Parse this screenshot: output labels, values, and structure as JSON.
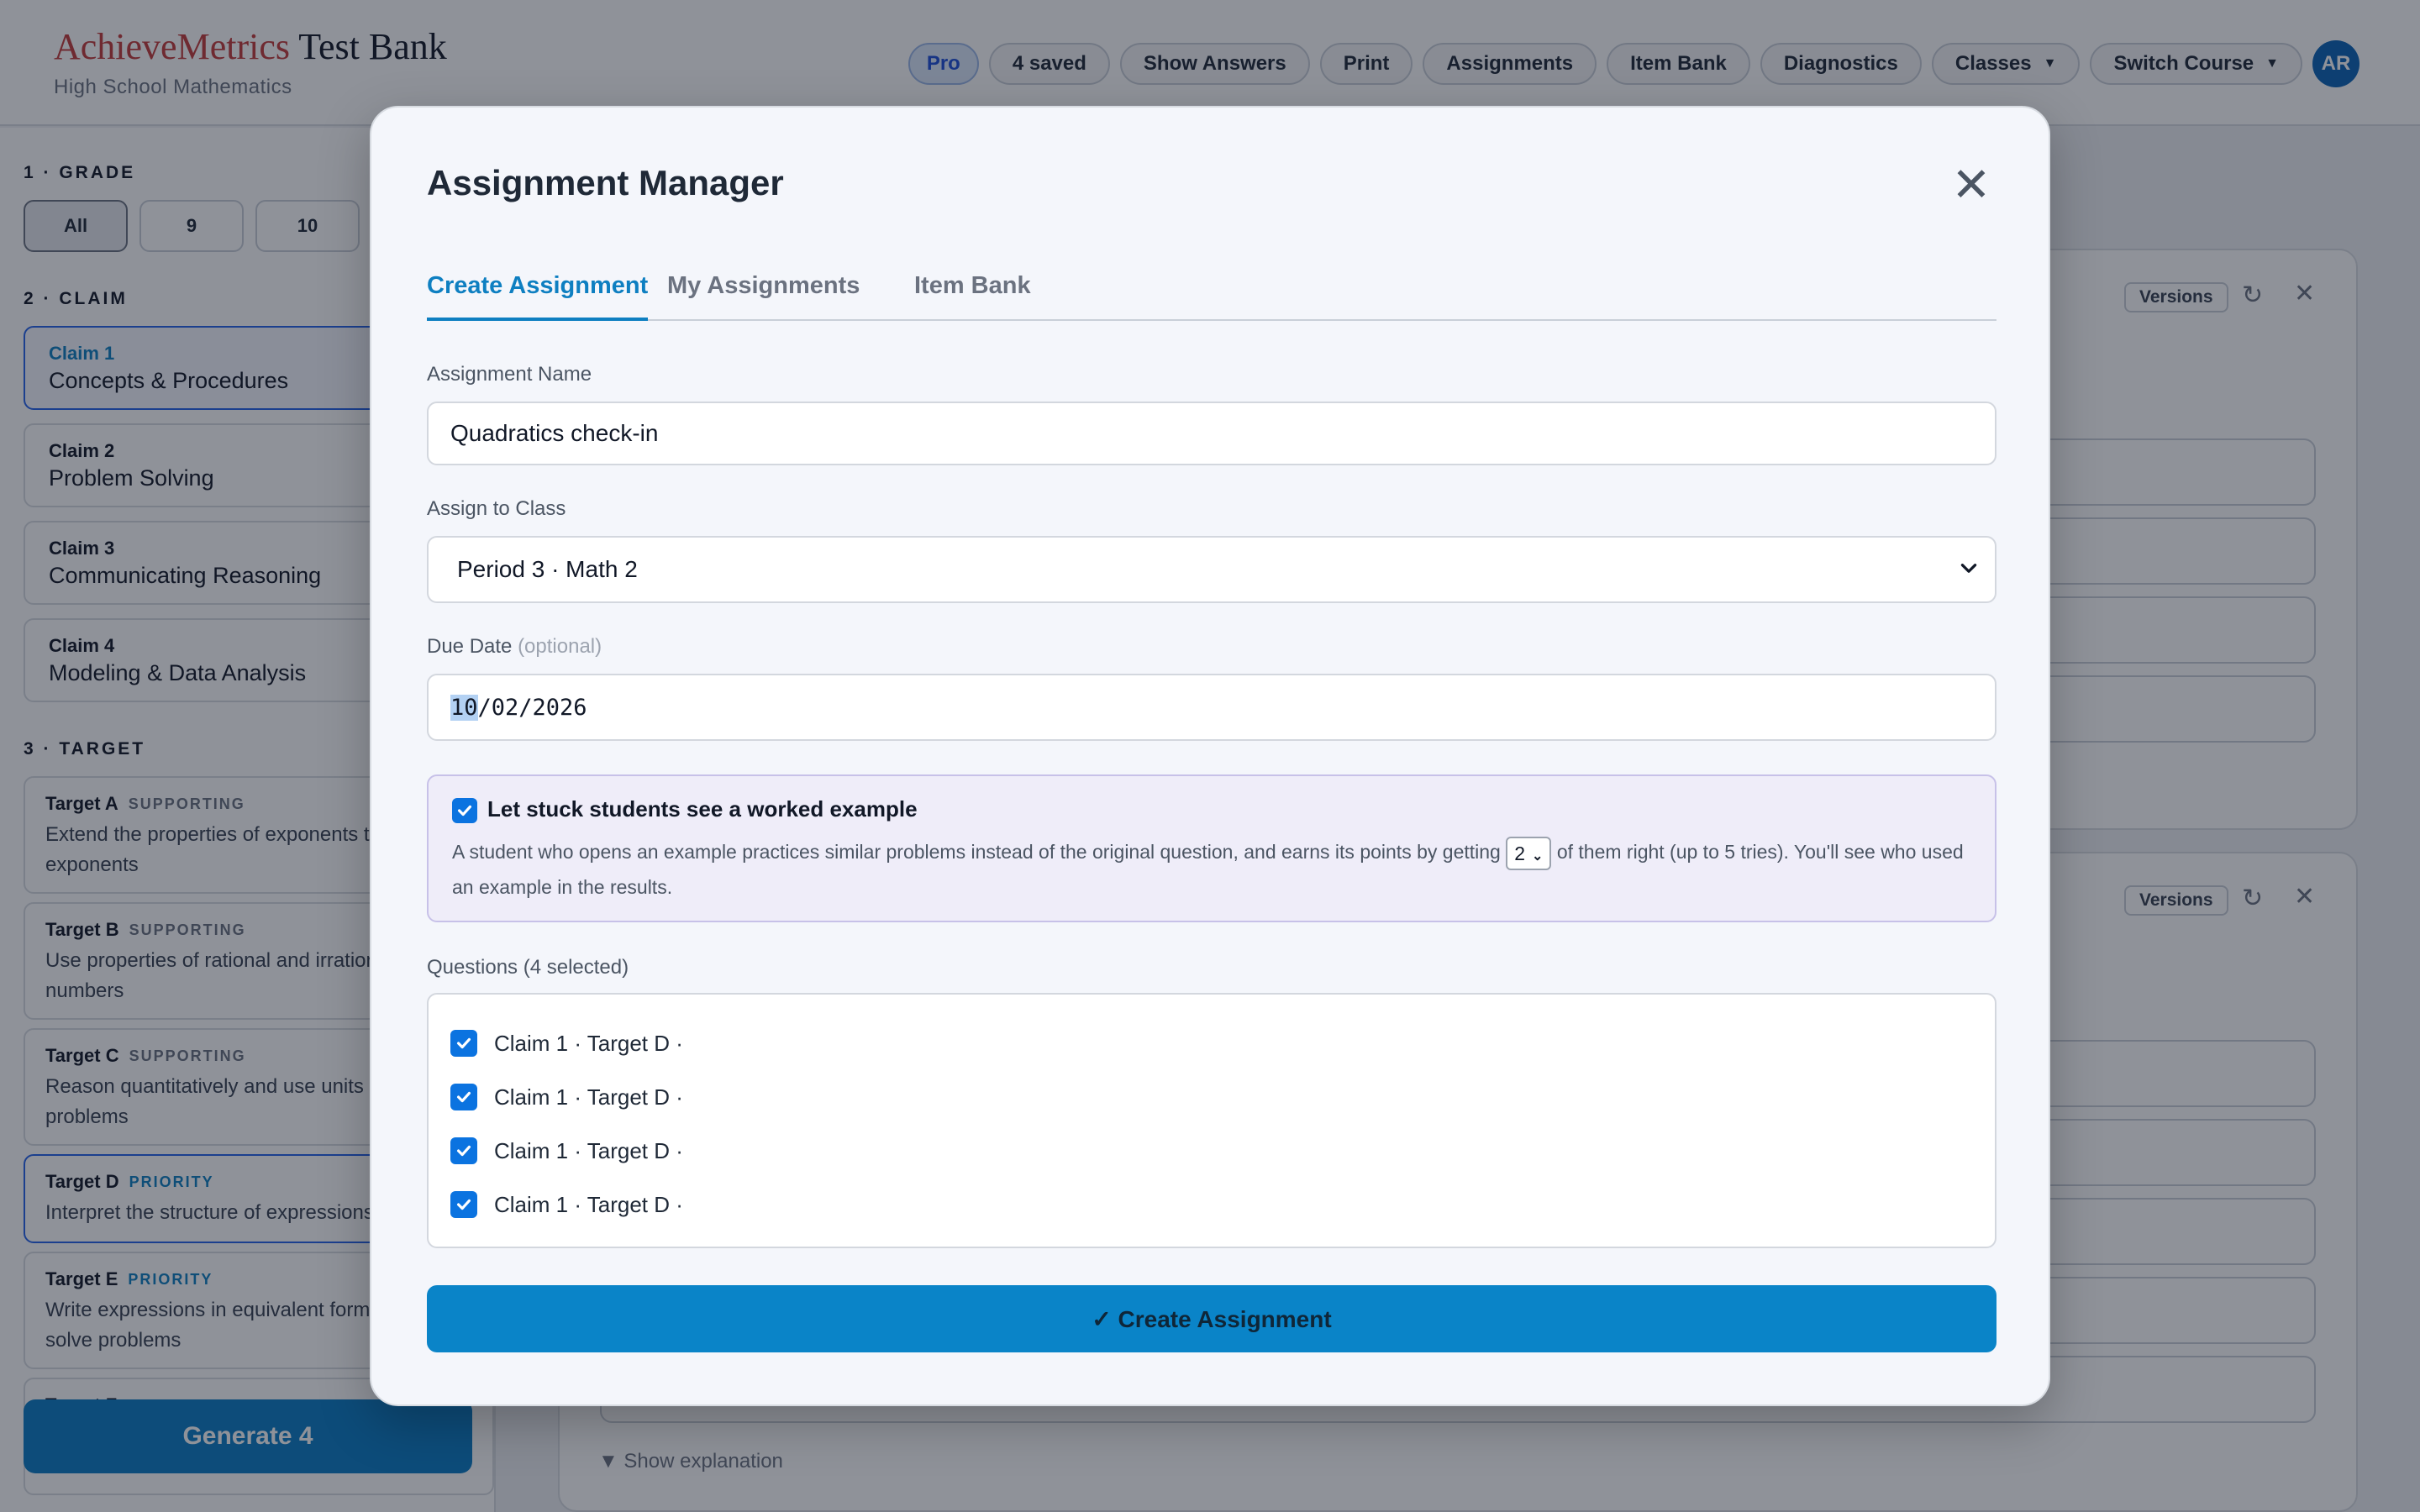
{
  "header": {
    "brand_primary": "AchieveMetrics",
    "brand_secondary": " Test Bank",
    "subtitle": "High School Mathematics",
    "plan_badge": "Pro",
    "saved": "4 saved",
    "actions": [
      "Show Answers",
      "Print",
      "Assignments",
      "Item Bank",
      "Diagnostics"
    ],
    "classes_label": "Classes",
    "switch_course_label": "Switch Course",
    "avatar_initials": "AR"
  },
  "sidebar": {
    "grade_title": "1 · GRADE",
    "grades": [
      "All",
      "9",
      "10"
    ],
    "claim_title": "2 · CLAIM",
    "claims": [
      {
        "num": "Claim 1",
        "name": "Concepts & Procedures"
      },
      {
        "num": "Claim 2",
        "name": "Problem Solving"
      },
      {
        "num": "Claim 3",
        "name": "Communicating Reasoning"
      },
      {
        "num": "Claim 4",
        "name": "Modeling & Data Analysis"
      }
    ],
    "target_title": "3 · TARGET",
    "targets": [
      {
        "name": "Target A",
        "tag": "SUPPORTING",
        "desc1": "Extend the properties of exponents to",
        "desc2": "exponents"
      },
      {
        "name": "Target B",
        "tag": "SUPPORTING",
        "desc1": "Use properties of rational and irrational",
        "desc2": "numbers"
      },
      {
        "name": "Target C",
        "tag": "SUPPORTING",
        "desc1": "Reason quantitatively and use units to",
        "desc2": "problems"
      },
      {
        "name": "Target D",
        "tag": "PRIORITY",
        "desc1": "Interpret the structure of expressions",
        "desc2": ""
      },
      {
        "name": "Target E",
        "tag": "PRIORITY",
        "desc1": "Write expressions in equivalent forms to",
        "desc2": "solve problems"
      },
      {
        "name": "Target F",
        "tag": "PRIORITY",
        "desc1": "",
        "desc2": ""
      }
    ],
    "generate_label": "Generate 4"
  },
  "background": {
    "versions_label": "Versions",
    "show_explanation": "▼ Show explanation"
  },
  "modal": {
    "title": "Assignment Manager",
    "close_glyph": "✕",
    "tabs": [
      "Create Assignment",
      "My Assignments",
      "Item Bank"
    ],
    "name_label": "Assignment Name",
    "name_value": "Quadratics check-in",
    "class_label": "Assign to Class",
    "class_value": "Period 3 · Math 2",
    "due_label": "Due Date",
    "due_optional": "(optional)",
    "due_month": "10",
    "due_rest": "/02/2026",
    "worked_title": "Let stuck students see a worked example",
    "worked_desc_before": "A student who opens an example practices similar problems instead of the original question, and earns its points by getting",
    "worked_count": "2",
    "worked_desc_after": "of them right (up to 5 tries). You'll see who used an example in the results.",
    "questions_label": "Questions (4 selected)",
    "questions": [
      "Claim 1 · Target D ·",
      "Claim 1 · Target D ·",
      "Claim 1 · Target D ·",
      "Claim 1 · Target D ·"
    ],
    "create_label": "✓ Create Assignment"
  },
  "colors": {
    "accent": "#0e7fc1",
    "brand_red": "#c23b3b",
    "overlay": "rgba(17,24,39,0.47)",
    "checkbox": "#0b73e0",
    "primary_button": "#0a84c8"
  },
  "icons": [
    "close-icon",
    "chevron-down-icon",
    "checkmark-icon",
    "refresh-icon",
    "caret-down-icon"
  ]
}
